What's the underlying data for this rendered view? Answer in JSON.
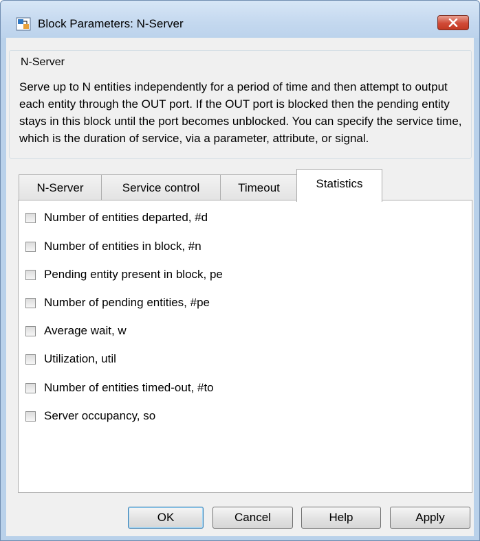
{
  "window": {
    "title": "Block Parameters: N-Server",
    "icon": "simulink-block-icon",
    "close_icon": "close-icon"
  },
  "group": {
    "legend": "N-Server",
    "description": "Serve up to N entities independently for a period of time and then attempt to output each entity through the OUT port. If the OUT port is blocked then the pending entity stays in this block until the port becomes unblocked. You can specify the service time, which is the duration of service, via a parameter, attribute, or signal."
  },
  "tabs": [
    {
      "label": "N-Server",
      "active": false
    },
    {
      "label": "Service control",
      "active": false
    },
    {
      "label": "Timeout",
      "active": false
    },
    {
      "label": "Statistics",
      "active": true
    }
  ],
  "statistics": [
    {
      "label": "Number of entities departed, #d",
      "checked": false
    },
    {
      "label": "Number of entities in block, #n",
      "checked": false
    },
    {
      "label": "Pending entity present in block, pe",
      "checked": false
    },
    {
      "label": "Number of pending entities, #pe",
      "checked": false
    },
    {
      "label": "Average wait, w",
      "checked": false
    },
    {
      "label": "Utilization, util",
      "checked": false
    },
    {
      "label": "Number of entities timed-out, #to",
      "checked": false
    },
    {
      "label": "Server occupancy, so",
      "checked": false
    }
  ],
  "buttons": {
    "ok": "OK",
    "cancel": "Cancel",
    "help": "Help",
    "apply": "Apply"
  }
}
